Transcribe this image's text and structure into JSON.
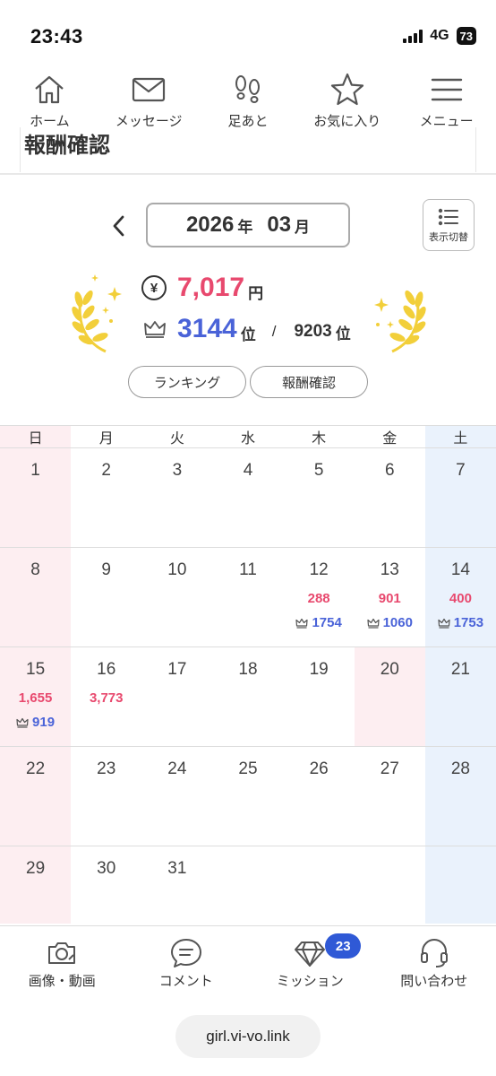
{
  "status_bar": {
    "time": "23:43",
    "network": "4G",
    "battery": "73"
  },
  "top_nav": [
    {
      "label": "ホーム",
      "icon": "home-icon"
    },
    {
      "label": "メッセージ",
      "icon": "mail-icon"
    },
    {
      "label": "足あと",
      "icon": "footprints-icon"
    },
    {
      "label": "お気に入り",
      "icon": "star-icon"
    },
    {
      "label": "メニュー",
      "icon": "menu-icon"
    }
  ],
  "section": {
    "cut_heading": "報酬確認"
  },
  "month_selector": {
    "year": "2026",
    "year_unit": "年",
    "month": "03",
    "month_unit": "月",
    "toggle_label": "表示切替"
  },
  "summary": {
    "yen_symbol": "¥",
    "amount": "7,017",
    "amount_unit": "円",
    "rank": "3144",
    "rank_unit": "位",
    "separator": "/",
    "total": "9203",
    "total_unit": "位",
    "buttons": {
      "ranking": "ランキング",
      "reward": "報酬確認"
    }
  },
  "calendar": {
    "weekdays": [
      "日",
      "月",
      "火",
      "水",
      "木",
      "金",
      "土"
    ],
    "weeks": [
      [
        {
          "day": "1"
        },
        {
          "day": "2"
        },
        {
          "day": "3"
        },
        {
          "day": "4"
        },
        {
          "day": "5"
        },
        {
          "day": "6"
        },
        {
          "day": "7"
        }
      ],
      [
        {
          "day": "8"
        },
        {
          "day": "9"
        },
        {
          "day": "10"
        },
        {
          "day": "11"
        },
        {
          "day": "12",
          "amount": "288",
          "rank": "1754"
        },
        {
          "day": "13",
          "amount": "901",
          "rank": "1060"
        },
        {
          "day": "14",
          "amount": "400",
          "rank": "1753"
        }
      ],
      [
        {
          "day": "15",
          "amount": "1,655",
          "rank": "919"
        },
        {
          "day": "16",
          "amount": "3,773"
        },
        {
          "day": "17"
        },
        {
          "day": "18"
        },
        {
          "day": "19"
        },
        {
          "day": "20",
          "highlight": true
        },
        {
          "day": "21"
        }
      ],
      [
        {
          "day": "22"
        },
        {
          "day": "23"
        },
        {
          "day": "24"
        },
        {
          "day": "25"
        },
        {
          "day": "26"
        },
        {
          "day": "27"
        },
        {
          "day": "28"
        }
      ],
      [
        {
          "day": "29"
        },
        {
          "day": "30"
        },
        {
          "day": "31"
        },
        {
          "day": ""
        },
        {
          "day": ""
        },
        {
          "day": ""
        },
        {
          "day": ""
        }
      ]
    ]
  },
  "bottom_nav": [
    {
      "label": "画像・動画",
      "icon": "camera-icon"
    },
    {
      "label": "コメント",
      "icon": "comment-icon"
    },
    {
      "label": "ミッション",
      "icon": "diamond-icon",
      "badge": "23"
    },
    {
      "label": "問い合わせ",
      "icon": "headset-icon"
    }
  ],
  "url": "girl.vi-vo.link",
  "colors": {
    "amount": "#e8496e",
    "rank": "#4a63d8",
    "sunday_bg": "#fdeef1",
    "saturday_bg": "#eaf2fc",
    "badge": "#2f59d6",
    "laurel": "#f2cf3a"
  }
}
